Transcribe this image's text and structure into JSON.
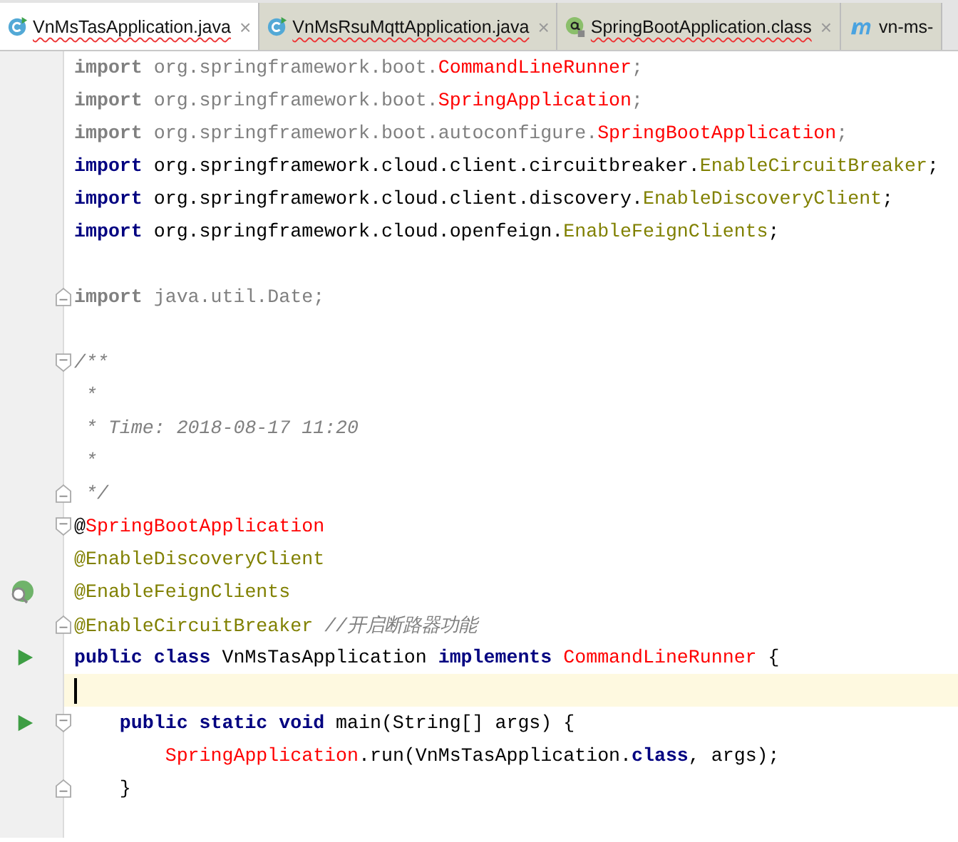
{
  "tabs": [
    {
      "label": "VnMsTasApplication.java",
      "kind": "class",
      "close": "×",
      "selected": true
    },
    {
      "label": "VnMsRsuMqttApplication.java",
      "kind": "class",
      "close": "×",
      "selected": false
    },
    {
      "label": "SpringBootApplication.class",
      "kind": "annotation",
      "close": "×",
      "selected": false
    },
    {
      "label": "vn-ms-",
      "kind": "maven",
      "selected": false
    }
  ],
  "lines": [
    {
      "current": false,
      "tokens": [
        {
          "kind": "unused-keyword",
          "text": "import "
        },
        {
          "kind": "unused",
          "text": "org.springframework.boot."
        },
        {
          "kind": "error",
          "text": "CommandLineRunner"
        },
        {
          "kind": "unused",
          "text": ";"
        }
      ]
    },
    {
      "current": false,
      "tokens": [
        {
          "kind": "unused-keyword",
          "text": "import "
        },
        {
          "kind": "unused",
          "text": "org.springframework.boot."
        },
        {
          "kind": "error",
          "text": "SpringApplication"
        },
        {
          "kind": "unused",
          "text": ";"
        }
      ]
    },
    {
      "current": false,
      "tokens": [
        {
          "kind": "unused-keyword",
          "text": "import "
        },
        {
          "kind": "unused",
          "text": "org.springframework.boot.autoconfigure."
        },
        {
          "kind": "error",
          "text": "SpringBootApplication"
        },
        {
          "kind": "unused",
          "text": ";"
        }
      ]
    },
    {
      "current": false,
      "tokens": [
        {
          "kind": "keyword",
          "text": "import "
        },
        {
          "kind": "plain",
          "text": "org.springframework.cloud.client.circuitbreaker."
        },
        {
          "kind": "annotation",
          "text": "EnableCircuitBreaker"
        },
        {
          "kind": "plain",
          "text": ";"
        }
      ]
    },
    {
      "current": false,
      "tokens": [
        {
          "kind": "keyword",
          "text": "import "
        },
        {
          "kind": "plain",
          "text": "org.springframework.cloud.client.discovery."
        },
        {
          "kind": "annotation",
          "text": "EnableDiscoveryClient"
        },
        {
          "kind": "plain",
          "text": ";"
        }
      ]
    },
    {
      "current": false,
      "tokens": [
        {
          "kind": "keyword",
          "text": "import "
        },
        {
          "kind": "plain",
          "text": "org.springframework.cloud.openfeign."
        },
        {
          "kind": "annotation",
          "text": "EnableFeignClients"
        },
        {
          "kind": "plain",
          "text": ";"
        }
      ]
    },
    {
      "current": false
    },
    {
      "current": false,
      "markers": [
        {
          "kind": "fold-end"
        }
      ],
      "tokens": [
        {
          "kind": "unused-keyword",
          "text": "import "
        },
        {
          "kind": "unused",
          "text": "java.util.Date;"
        }
      ]
    },
    {
      "current": false
    },
    {
      "current": false,
      "markers": [
        {
          "kind": "fold-start"
        }
      ],
      "tokens": [
        {
          "kind": "doc",
          "text": "/**"
        }
      ]
    },
    {
      "current": false,
      "tokens": [
        {
          "kind": "doc",
          "text": " *"
        }
      ]
    },
    {
      "current": false,
      "tokens": [
        {
          "kind": "doc",
          "text": " * Time: 2018-08-17 11:20"
        }
      ]
    },
    {
      "current": false,
      "tokens": [
        {
          "kind": "doc",
          "text": " *"
        }
      ]
    },
    {
      "current": false,
      "markers": [
        {
          "kind": "fold-end"
        }
      ],
      "tokens": [
        {
          "kind": "doc",
          "text": " */"
        }
      ]
    },
    {
      "current": false,
      "markers": [
        {
          "kind": "fold-start"
        }
      ],
      "tokens": [
        {
          "kind": "plain",
          "text": "@"
        },
        {
          "kind": "error",
          "text": "SpringBootApplication"
        }
      ]
    },
    {
      "current": false,
      "tokens": [
        {
          "kind": "annotation",
          "text": "@EnableDiscoveryClient"
        }
      ]
    },
    {
      "current": false,
      "markers": [
        {
          "kind": "bean"
        }
      ],
      "tokens": [
        {
          "kind": "annotation",
          "text": "@EnableFeignClients"
        }
      ]
    },
    {
      "current": false,
      "markers": [
        {
          "kind": "fold-end"
        }
      ],
      "tokens": [
        {
          "kind": "annotation",
          "text": "@EnableCircuitBreaker "
        },
        {
          "kind": "comment",
          "text": "//开启断路器功能"
        }
      ]
    },
    {
      "current": false,
      "markers": [
        {
          "kind": "run"
        }
      ],
      "tokens": [
        {
          "kind": "keyword",
          "text": "public class "
        },
        {
          "kind": "plain",
          "text": "VnMsTasApplication "
        },
        {
          "kind": "keyword",
          "text": "implements "
        },
        {
          "kind": "error",
          "text": "CommandLineRunner"
        },
        {
          "kind": "plain",
          "text": " {"
        }
      ]
    },
    {
      "current": true
    },
    {
      "current": false,
      "markers": [
        {
          "kind": "run"
        },
        {
          "kind": "fold-start"
        }
      ],
      "tokens": [
        {
          "kind": "keyword",
          "text": "    public static void "
        },
        {
          "kind": "plain",
          "text": "main(String[] args) {"
        }
      ]
    },
    {
      "current": false,
      "tokens": [
        {
          "kind": "error",
          "text": "        SpringApplication"
        },
        {
          "kind": "plain",
          "text": ".run(VnMsTasApplication."
        },
        {
          "kind": "keyword",
          "text": "class"
        },
        {
          "kind": "plain",
          "text": ", args);"
        }
      ]
    },
    {
      "current": false,
      "markers": [
        {
          "kind": "fold-end"
        }
      ],
      "tokens": [
        {
          "kind": "plain",
          "text": "    }"
        }
      ]
    },
    {
      "current": false
    }
  ]
}
